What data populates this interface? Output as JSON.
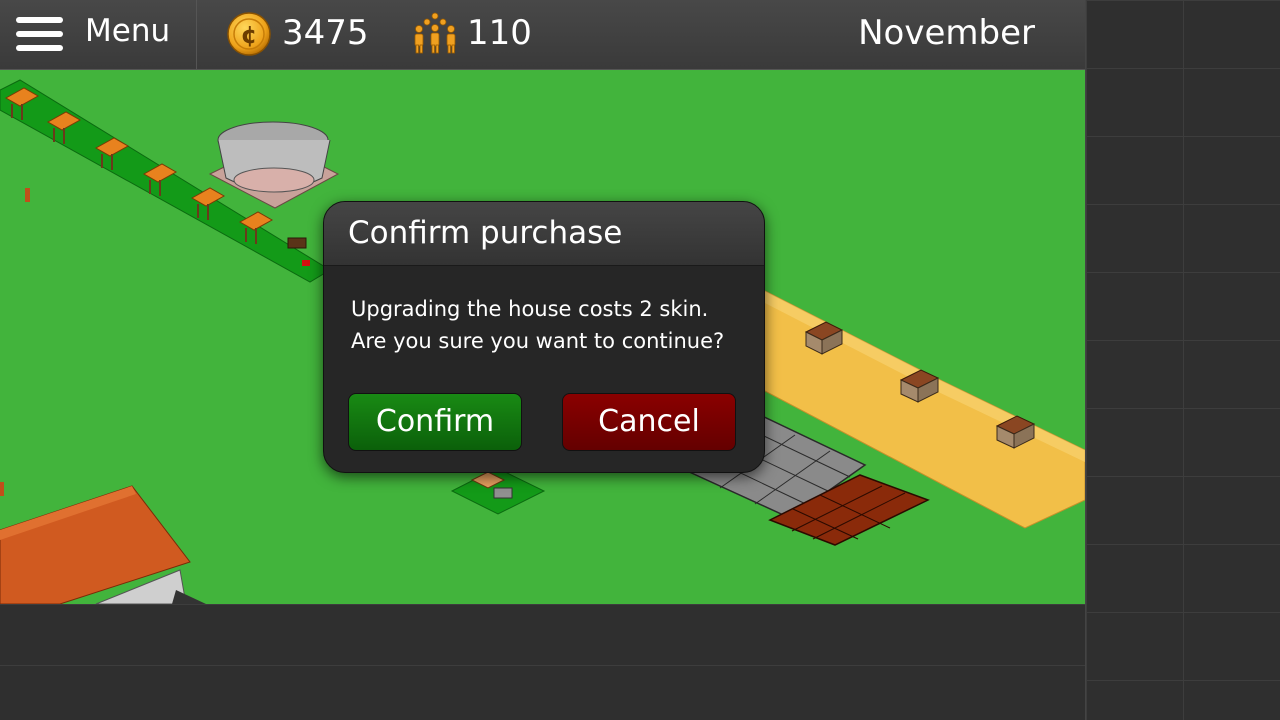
{
  "topbar": {
    "menu_label": "Menu",
    "coins": "3475",
    "population": "110",
    "month": "November"
  },
  "dialog": {
    "title": "Confirm purchase",
    "message_line1": "Upgrading the house costs 2 skin.",
    "message_line2": "Are you sure you want to continue?",
    "confirm_label": "Confirm",
    "cancel_label": "Cancel"
  },
  "icons": {
    "menu": "hamburger-icon",
    "coins": "coin-icon",
    "population": "population-icon"
  },
  "colors": {
    "grass": "#42b43c",
    "confirm": "#0f700d",
    "cancel": "#780000",
    "coin": "#f1a82a"
  }
}
